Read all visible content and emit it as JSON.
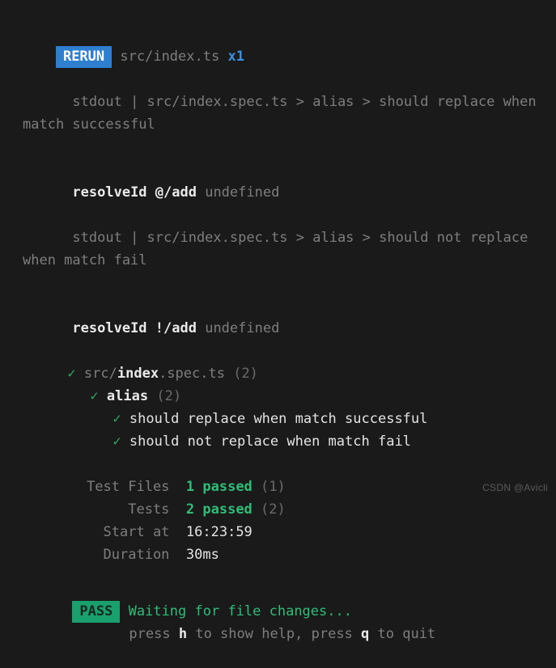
{
  "terminal": {
    "background_color": "#1a1a1a",
    "watermark": "CSDN @Avicli"
  },
  "rerun_header": {
    "badge_label": "RERUN",
    "badge_color": "#2f7fd1",
    "file": "src/index.ts",
    "count": "x1",
    "count_color": "#3b8fe0"
  },
  "stdout_blocks": [
    {
      "label": "stdout",
      "separator": "|",
      "spec_path": "src/index.spec.ts",
      "chevron_1": ">",
      "suite": "alias",
      "chevron_2": ">",
      "test_name": "should replace when match successful",
      "full_header": "stdout | src/index.spec.ts > alias > should replace when match successful",
      "log_key": "resolveId @/add",
      "log_value": "undefined"
    },
    {
      "label": "stdout",
      "separator": "|",
      "spec_path": "src/index.spec.ts",
      "chevron_1": ">",
      "suite": "alias",
      "chevron_2": ">",
      "test_name": "should not replace when match fail",
      "full_header": "stdout | src/index.spec.ts > alias > should not replace when match fail",
      "log_key": "resolveId !/add",
      "log_value": "undefined"
    }
  ],
  "test_tree": {
    "check_glyph": "✓",
    "file": {
      "path_prefix": "src/",
      "path_name": "index",
      "path_suffix": ".spec.ts",
      "count": "(2)"
    },
    "suite": {
      "name": "alias",
      "count": "(2)"
    },
    "tests": [
      {
        "name": "should replace when match successful"
      },
      {
        "name": "should not replace when match fail"
      }
    ]
  },
  "summary": {
    "rows": [
      {
        "label": "Test Files",
        "value": "1 passed",
        "count": "(1)"
      },
      {
        "label": "Tests",
        "value": "2 passed",
        "count": "(2)"
      },
      {
        "label": "Start at",
        "value": "16:23:59",
        "count": ""
      },
      {
        "label": "Duration",
        "value": "30ms",
        "count": ""
      }
    ]
  },
  "footer": {
    "badge_label": "PASS",
    "badge_color": "#1aa06d",
    "status_text": "Waiting for file changes...",
    "hint_prefix": "press ",
    "hint_key_help": "h",
    "hint_mid": " to show help, press ",
    "hint_key_quit": "q",
    "hint_suffix": " to quit"
  }
}
